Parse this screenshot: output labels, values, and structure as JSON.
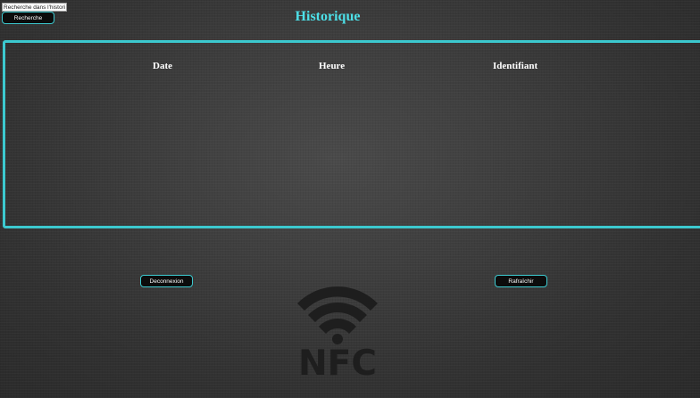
{
  "search": {
    "value": "Recherche dans l'historiqu",
    "button_label": "Recherche"
  },
  "header": {
    "title": "Historique"
  },
  "history_table": {
    "columns": [
      "Date",
      "Heure",
      "Identifiant"
    ],
    "rows": []
  },
  "actions": {
    "logout_label": "Deconnexion",
    "refresh_label": "Rafraîchir"
  },
  "logo": {
    "text": "NFC",
    "icon": "nfc-icon"
  },
  "colors": {
    "accent": "#3cc9cf",
    "title": "#4de0e8",
    "logo": "#1e1e1e"
  }
}
